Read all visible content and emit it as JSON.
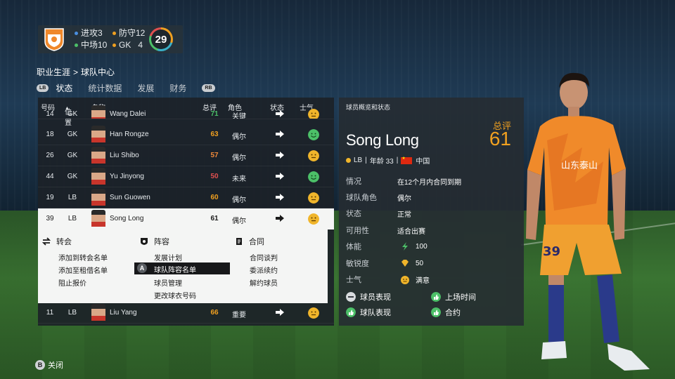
{
  "team": {
    "stats": [
      {
        "label": "进攻3",
        "color": "#4a8fe0"
      },
      {
        "label": "防守12",
        "color": "#f0a020"
      },
      {
        "label": "中场10",
        "color": "#4cc068"
      },
      {
        "label": "GK",
        "value": "4",
        "color": "#f0a020"
      }
    ],
    "overall": "29"
  },
  "breadcrumb": {
    "root": "职业生涯",
    "sep": ">",
    "current": "球队中心"
  },
  "tabs": {
    "lb": "LB",
    "rb": "RB",
    "items": [
      "状态",
      "统计数据",
      "发展",
      "财务"
    ]
  },
  "list": {
    "headers": {
      "num": "号码",
      "pos": "位置",
      "name": "名称",
      "ovr": "总评",
      "role": "角色",
      "status": "状态",
      "morale": "士气"
    },
    "rows": [
      {
        "num": "14",
        "pos": "GK",
        "name": "Wang Dalei",
        "ovr": "71",
        "role": "关键",
        "ovr_color": "#4cc068",
        "morale": "neutral"
      },
      {
        "num": "18",
        "pos": "GK",
        "name": "Han Rongze",
        "ovr": "63",
        "role": "偶尔",
        "ovr_color": "#f0a020",
        "morale": "happy"
      },
      {
        "num": "26",
        "pos": "GK",
        "name": "Liu Shibo",
        "ovr": "57",
        "role": "偶尔",
        "ovr_color": "#f08a3a",
        "morale": "neutral"
      },
      {
        "num": "44",
        "pos": "GK",
        "name": "Yu Jinyong",
        "ovr": "50",
        "role": "未来",
        "ovr_color": "#e05050",
        "morale": "happy"
      },
      {
        "num": "19",
        "pos": "LB",
        "name": "Sun Guowen",
        "ovr": "60",
        "role": "偶尔",
        "ovr_color": "#f0a020",
        "morale": "neutral"
      },
      {
        "num": "39",
        "pos": "LB",
        "name": "Song Long",
        "ovr": "61",
        "role": "偶尔",
        "ovr_color": "#1a1a1a",
        "morale": "neutral"
      },
      {
        "num": "11",
        "pos": "LB",
        "name": "Liu Yang",
        "ovr": "66",
        "role": "重要",
        "ovr_color": "#f0a020",
        "morale": "neutral"
      }
    ],
    "menu": {
      "col1": {
        "title": "转会",
        "items": [
          "添加到转会名单",
          "添加至租借名单",
          "阻止报价"
        ]
      },
      "col2": {
        "title": "阵容",
        "items": [
          "发展计划",
          "球队阵容名单",
          "球员管理",
          "更改球衣号码"
        ],
        "highlight_button": "A"
      },
      "col3": {
        "title": "合同",
        "items": [
          "合同谈判",
          "委派续约",
          "解约球员"
        ]
      }
    }
  },
  "detail": {
    "title": "球员概览和状态",
    "name": "Song Long",
    "ovr_label": "总评",
    "ovr": "61",
    "position": "LB",
    "age": "年龄 33",
    "nation": "中国",
    "rows": [
      {
        "label": "情况",
        "value": "在12个月内合同到期"
      },
      {
        "label": "球队角色",
        "value": "偶尔"
      },
      {
        "label": "状态",
        "value": "正常"
      },
      {
        "label": "可用性",
        "value": "适合出赛"
      },
      {
        "label": "体能",
        "value": "100",
        "icon": "lightning-icon"
      },
      {
        "label": "敏锐度",
        "value": "50",
        "icon": "diamond-icon"
      },
      {
        "label": "士气",
        "value": "满意",
        "icon": "neutral-face-icon"
      }
    ],
    "tags": [
      {
        "label": "球员表现",
        "type": "neutral"
      },
      {
        "label": "上场时间",
        "type": "positive"
      },
      {
        "label": "球队表现",
        "type": "positive"
      },
      {
        "label": "合约",
        "type": "positive"
      }
    ]
  },
  "player_figure": {
    "shirt_number": "39",
    "sponsor": "山东泰山"
  },
  "footer": {
    "button": "B",
    "label": "关闭"
  }
}
